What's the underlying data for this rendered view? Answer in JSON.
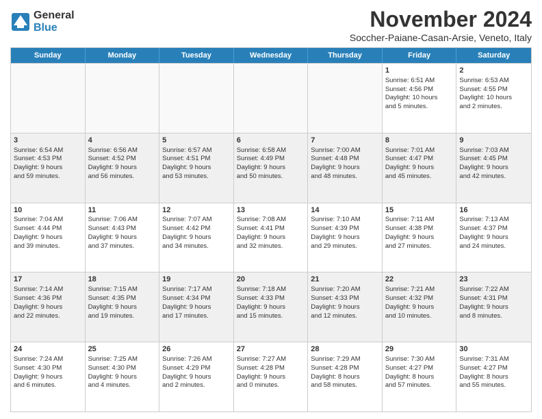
{
  "logo": {
    "general": "General",
    "blue": "Blue"
  },
  "header": {
    "month": "November 2024",
    "location": "Soccher-Paiane-Casan-Arsie, Veneto, Italy"
  },
  "weekdays": [
    "Sunday",
    "Monday",
    "Tuesday",
    "Wednesday",
    "Thursday",
    "Friday",
    "Saturday"
  ],
  "rows": [
    [
      {
        "day": "",
        "info": "",
        "empty": true
      },
      {
        "day": "",
        "info": "",
        "empty": true
      },
      {
        "day": "",
        "info": "",
        "empty": true
      },
      {
        "day": "",
        "info": "",
        "empty": true
      },
      {
        "day": "",
        "info": "",
        "empty": true
      },
      {
        "day": "1",
        "info": "Sunrise: 6:51 AM\nSunset: 4:56 PM\nDaylight: 10 hours\nand 5 minutes.",
        "empty": false
      },
      {
        "day": "2",
        "info": "Sunrise: 6:53 AM\nSunset: 4:55 PM\nDaylight: 10 hours\nand 2 minutes.",
        "empty": false
      }
    ],
    [
      {
        "day": "3",
        "info": "Sunrise: 6:54 AM\nSunset: 4:53 PM\nDaylight: 9 hours\nand 59 minutes.",
        "empty": false
      },
      {
        "day": "4",
        "info": "Sunrise: 6:56 AM\nSunset: 4:52 PM\nDaylight: 9 hours\nand 56 minutes.",
        "empty": false
      },
      {
        "day": "5",
        "info": "Sunrise: 6:57 AM\nSunset: 4:51 PM\nDaylight: 9 hours\nand 53 minutes.",
        "empty": false
      },
      {
        "day": "6",
        "info": "Sunrise: 6:58 AM\nSunset: 4:49 PM\nDaylight: 9 hours\nand 50 minutes.",
        "empty": false
      },
      {
        "day": "7",
        "info": "Sunrise: 7:00 AM\nSunset: 4:48 PM\nDaylight: 9 hours\nand 48 minutes.",
        "empty": false
      },
      {
        "day": "8",
        "info": "Sunrise: 7:01 AM\nSunset: 4:47 PM\nDaylight: 9 hours\nand 45 minutes.",
        "empty": false
      },
      {
        "day": "9",
        "info": "Sunrise: 7:03 AM\nSunset: 4:45 PM\nDaylight: 9 hours\nand 42 minutes.",
        "empty": false
      }
    ],
    [
      {
        "day": "10",
        "info": "Sunrise: 7:04 AM\nSunset: 4:44 PM\nDaylight: 9 hours\nand 39 minutes.",
        "empty": false
      },
      {
        "day": "11",
        "info": "Sunrise: 7:06 AM\nSunset: 4:43 PM\nDaylight: 9 hours\nand 37 minutes.",
        "empty": false
      },
      {
        "day": "12",
        "info": "Sunrise: 7:07 AM\nSunset: 4:42 PM\nDaylight: 9 hours\nand 34 minutes.",
        "empty": false
      },
      {
        "day": "13",
        "info": "Sunrise: 7:08 AM\nSunset: 4:41 PM\nDaylight: 9 hours\nand 32 minutes.",
        "empty": false
      },
      {
        "day": "14",
        "info": "Sunrise: 7:10 AM\nSunset: 4:39 PM\nDaylight: 9 hours\nand 29 minutes.",
        "empty": false
      },
      {
        "day": "15",
        "info": "Sunrise: 7:11 AM\nSunset: 4:38 PM\nDaylight: 9 hours\nand 27 minutes.",
        "empty": false
      },
      {
        "day": "16",
        "info": "Sunrise: 7:13 AM\nSunset: 4:37 PM\nDaylight: 9 hours\nand 24 minutes.",
        "empty": false
      }
    ],
    [
      {
        "day": "17",
        "info": "Sunrise: 7:14 AM\nSunset: 4:36 PM\nDaylight: 9 hours\nand 22 minutes.",
        "empty": false
      },
      {
        "day": "18",
        "info": "Sunrise: 7:15 AM\nSunset: 4:35 PM\nDaylight: 9 hours\nand 19 minutes.",
        "empty": false
      },
      {
        "day": "19",
        "info": "Sunrise: 7:17 AM\nSunset: 4:34 PM\nDaylight: 9 hours\nand 17 minutes.",
        "empty": false
      },
      {
        "day": "20",
        "info": "Sunrise: 7:18 AM\nSunset: 4:33 PM\nDaylight: 9 hours\nand 15 minutes.",
        "empty": false
      },
      {
        "day": "21",
        "info": "Sunrise: 7:20 AM\nSunset: 4:33 PM\nDaylight: 9 hours\nand 12 minutes.",
        "empty": false
      },
      {
        "day": "22",
        "info": "Sunrise: 7:21 AM\nSunset: 4:32 PM\nDaylight: 9 hours\nand 10 minutes.",
        "empty": false
      },
      {
        "day": "23",
        "info": "Sunrise: 7:22 AM\nSunset: 4:31 PM\nDaylight: 9 hours\nand 8 minutes.",
        "empty": false
      }
    ],
    [
      {
        "day": "24",
        "info": "Sunrise: 7:24 AM\nSunset: 4:30 PM\nDaylight: 9 hours\nand 6 minutes.",
        "empty": false
      },
      {
        "day": "25",
        "info": "Sunrise: 7:25 AM\nSunset: 4:30 PM\nDaylight: 9 hours\nand 4 minutes.",
        "empty": false
      },
      {
        "day": "26",
        "info": "Sunrise: 7:26 AM\nSunset: 4:29 PM\nDaylight: 9 hours\nand 2 minutes.",
        "empty": false
      },
      {
        "day": "27",
        "info": "Sunrise: 7:27 AM\nSunset: 4:28 PM\nDaylight: 9 hours\nand 0 minutes.",
        "empty": false
      },
      {
        "day": "28",
        "info": "Sunrise: 7:29 AM\nSunset: 4:28 PM\nDaylight: 8 hours\nand 58 minutes.",
        "empty": false
      },
      {
        "day": "29",
        "info": "Sunrise: 7:30 AM\nSunset: 4:27 PM\nDaylight: 8 hours\nand 57 minutes.",
        "empty": false
      },
      {
        "day": "30",
        "info": "Sunrise: 7:31 AM\nSunset: 4:27 PM\nDaylight: 8 hours\nand 55 minutes.",
        "empty": false
      }
    ]
  ]
}
